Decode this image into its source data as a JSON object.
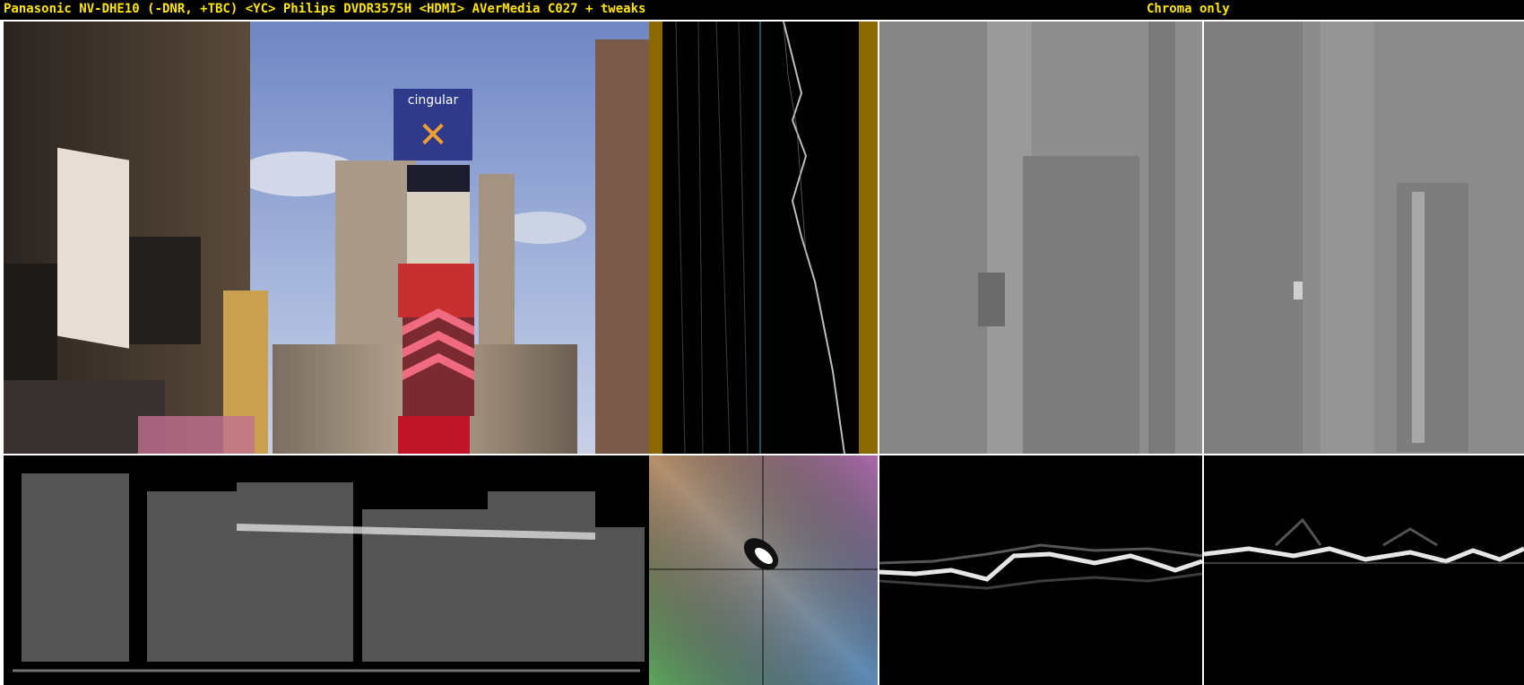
{
  "header": {
    "title": "Panasonic NV-DHE10 (-DNR, +TBC) <YC> Philips DVDR3575H <HDMI> AVerMedia C027 + tweaks",
    "mode_label": "Chroma only"
  },
  "colors": {
    "header_text": "#ffe600",
    "header_bg": "#000000",
    "divider": "#ffffff",
    "vectorscope_border_left": "#8a6a00",
    "vectorscope_axis": "#2fb5b5"
  },
  "panels": {
    "video_frame": {
      "icon": "video-frame-icon"
    },
    "chroma_graph": {
      "icon": "vertical-waveform-icon"
    },
    "chroma_u": {
      "icon": "chroma-u-icon"
    },
    "chroma_v": {
      "icon": "chroma-v-icon"
    },
    "luma_waveform": {
      "icon": "waveform-icon"
    },
    "vectorscope": {
      "icon": "vectorscope-icon"
    },
    "u_waveform": {
      "icon": "waveform-icon"
    },
    "v_waveform": {
      "icon": "waveform-icon"
    }
  }
}
